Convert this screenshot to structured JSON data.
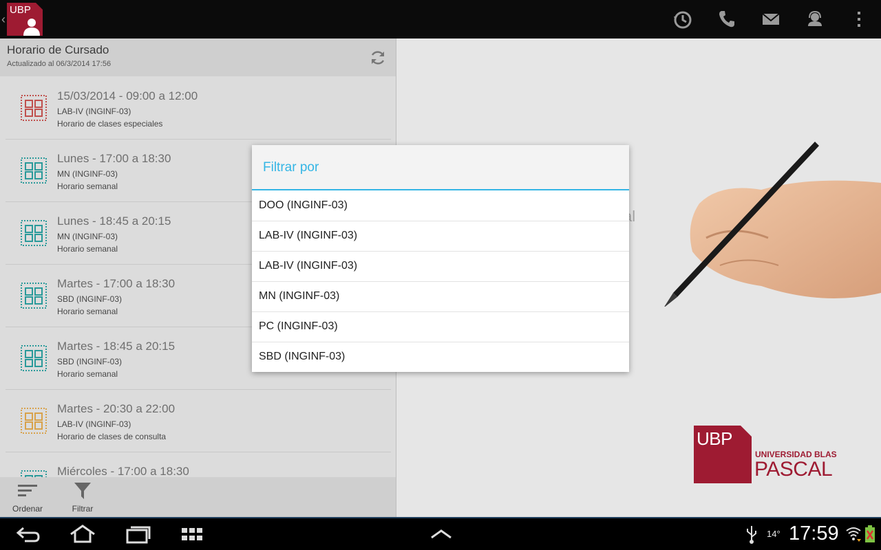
{
  "action_bar": {
    "logo_text": "UBP",
    "icons": [
      "history-icon",
      "phone-icon",
      "mail-icon",
      "contact-icon",
      "overflow-menu-icon"
    ]
  },
  "list_header": {
    "title": "Horario de Cursado",
    "subtitle": "Actualizado al 06/3/2014 17:56"
  },
  "schedule": [
    {
      "title": "15/03/2014 - 09:00 a 12:00",
      "course": "LAB-IV (INGINF-03)",
      "type": "Horario de clases especiales",
      "icon_color": "#c0504d"
    },
    {
      "title": "Lunes - 17:00 a 18:30",
      "course": "MN (INGINF-03)",
      "type": "Horario semanal",
      "icon_color": "#2a9a9a"
    },
    {
      "title": "Lunes - 18:45 a 20:15",
      "course": "MN (INGINF-03)",
      "type": "Horario semanal",
      "icon_color": "#2a9a9a"
    },
    {
      "title": "Martes - 17:00 a 18:30",
      "course": "SBD (INGINF-03)",
      "type": "Horario semanal",
      "icon_color": "#2a9a9a"
    },
    {
      "title": "Martes - 18:45 a 20:15",
      "course": "SBD (INGINF-03)",
      "type": "Horario semanal",
      "icon_color": "#2a9a9a"
    },
    {
      "title": "Martes - 20:30 a 22:00",
      "course": "LAB-IV (INGINF-03)",
      "type": "Horario de clases de consulta",
      "icon_color": "#d8a24a"
    },
    {
      "title": "Miércoles - 17:00 a 18:30",
      "course": "",
      "type": "",
      "icon_color": "#2a9a9a"
    }
  ],
  "bottom_bar": {
    "sort_label": "Ordenar",
    "filter_label": "Filtrar"
  },
  "hero": {
    "partial_text": "al",
    "logo_text": "UBP",
    "name_line1": "UNIVERSIDAD BLAS",
    "name_line2": "PASCAL",
    "brand_color": "#9e1b32"
  },
  "dialog": {
    "title": "Filtrar por",
    "items": [
      "DOO (INGINF-03)",
      "LAB-IV (INGINF-03)",
      "LAB-IV (INGINF-03)",
      "MN (INGINF-03)",
      "PC (INGINF-03)",
      "SBD (INGINF-03)"
    ],
    "accent_color": "#33b5e5"
  },
  "status": {
    "temperature": "14°",
    "time": "17:59"
  }
}
